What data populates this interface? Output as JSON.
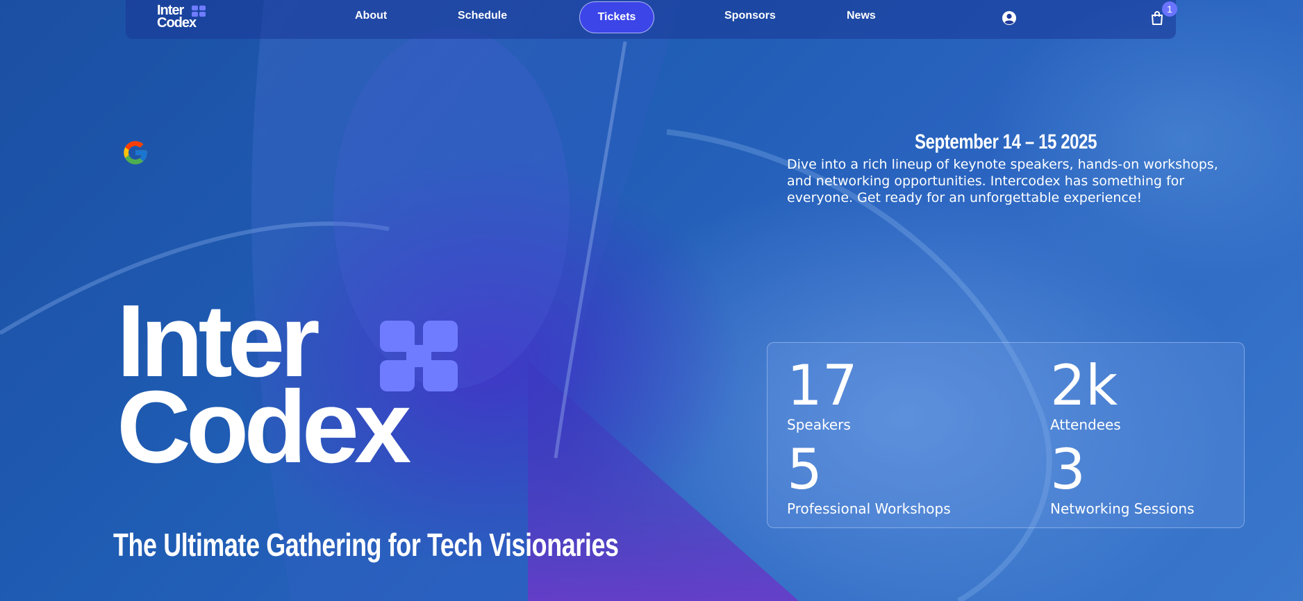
{
  "nav": {
    "logo_line1": "Inter",
    "logo_line2": "Codex",
    "items": [
      "About",
      "Schedule",
      "Tickets",
      "Sponsors",
      "News"
    ],
    "cart_count": "1",
    "accent": "#3b45e8"
  },
  "hero": {
    "date": "September 14 – 15 2025",
    "intro": "Dive into a rich lineup of keynote speakers, hands-on workshops, and networking opportunities. Intercodex has something for everyone. Get ready for an unforgettable experience!",
    "title_line1": "Inter",
    "title_line2": "Codex",
    "tagline": "The Ultimate Gathering for Tech Visionaries",
    "mark_color": "#6f7cff"
  },
  "stats": [
    {
      "value": "17",
      "label": "Speakers"
    },
    {
      "value": "2k",
      "label": "Attendees"
    },
    {
      "value": "5",
      "label": "Professional Workshops"
    },
    {
      "value": "3",
      "label": "Networking Sessions"
    }
  ],
  "icons": [
    "google-icon",
    "user-icon",
    "cart-icon",
    "intercodex-mark-icon"
  ]
}
